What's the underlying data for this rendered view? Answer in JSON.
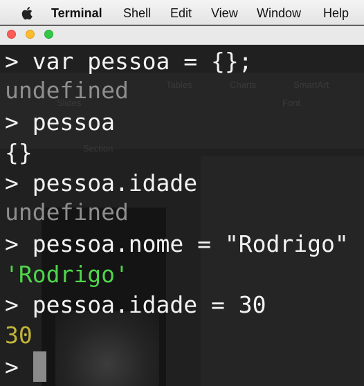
{
  "menubar": {
    "app_name": "Terminal",
    "items": [
      "Shell",
      "Edit",
      "View",
      "Window",
      "Help"
    ]
  },
  "terminal": {
    "lines": [
      {
        "text": "> var pessoa = {};",
        "kind": "input"
      },
      {
        "text": "undefined",
        "kind": "undefined"
      },
      {
        "text": "> pessoa",
        "kind": "input"
      },
      {
        "text": "{}",
        "kind": "output"
      },
      {
        "text": "> pessoa.idade",
        "kind": "input"
      },
      {
        "text": "undefined",
        "kind": "undefined"
      },
      {
        "text": "> pessoa.nome = \"Rodrigo\"",
        "kind": "input"
      },
      {
        "text": "'Rodrigo'",
        "kind": "string"
      },
      {
        "text": "> pessoa.idade = 30",
        "kind": "input"
      },
      {
        "text": "30",
        "kind": "number"
      },
      {
        "text": "> ",
        "kind": "prompt"
      }
    ]
  },
  "background_app": {
    "labels": [
      "Tables",
      "Charts",
      "SmartArt",
      "Slides",
      "Font",
      "Section"
    ]
  },
  "colors": {
    "terminal_bg": "#202020",
    "input_text": "#f2f2f2",
    "undefined_text": "#8e8e8e",
    "string_text": "#4fd54a",
    "number_text": "#c2b43a",
    "traffic_close": "#fc5b57",
    "traffic_minimize": "#fdbc2e",
    "traffic_maximize": "#33c748"
  }
}
